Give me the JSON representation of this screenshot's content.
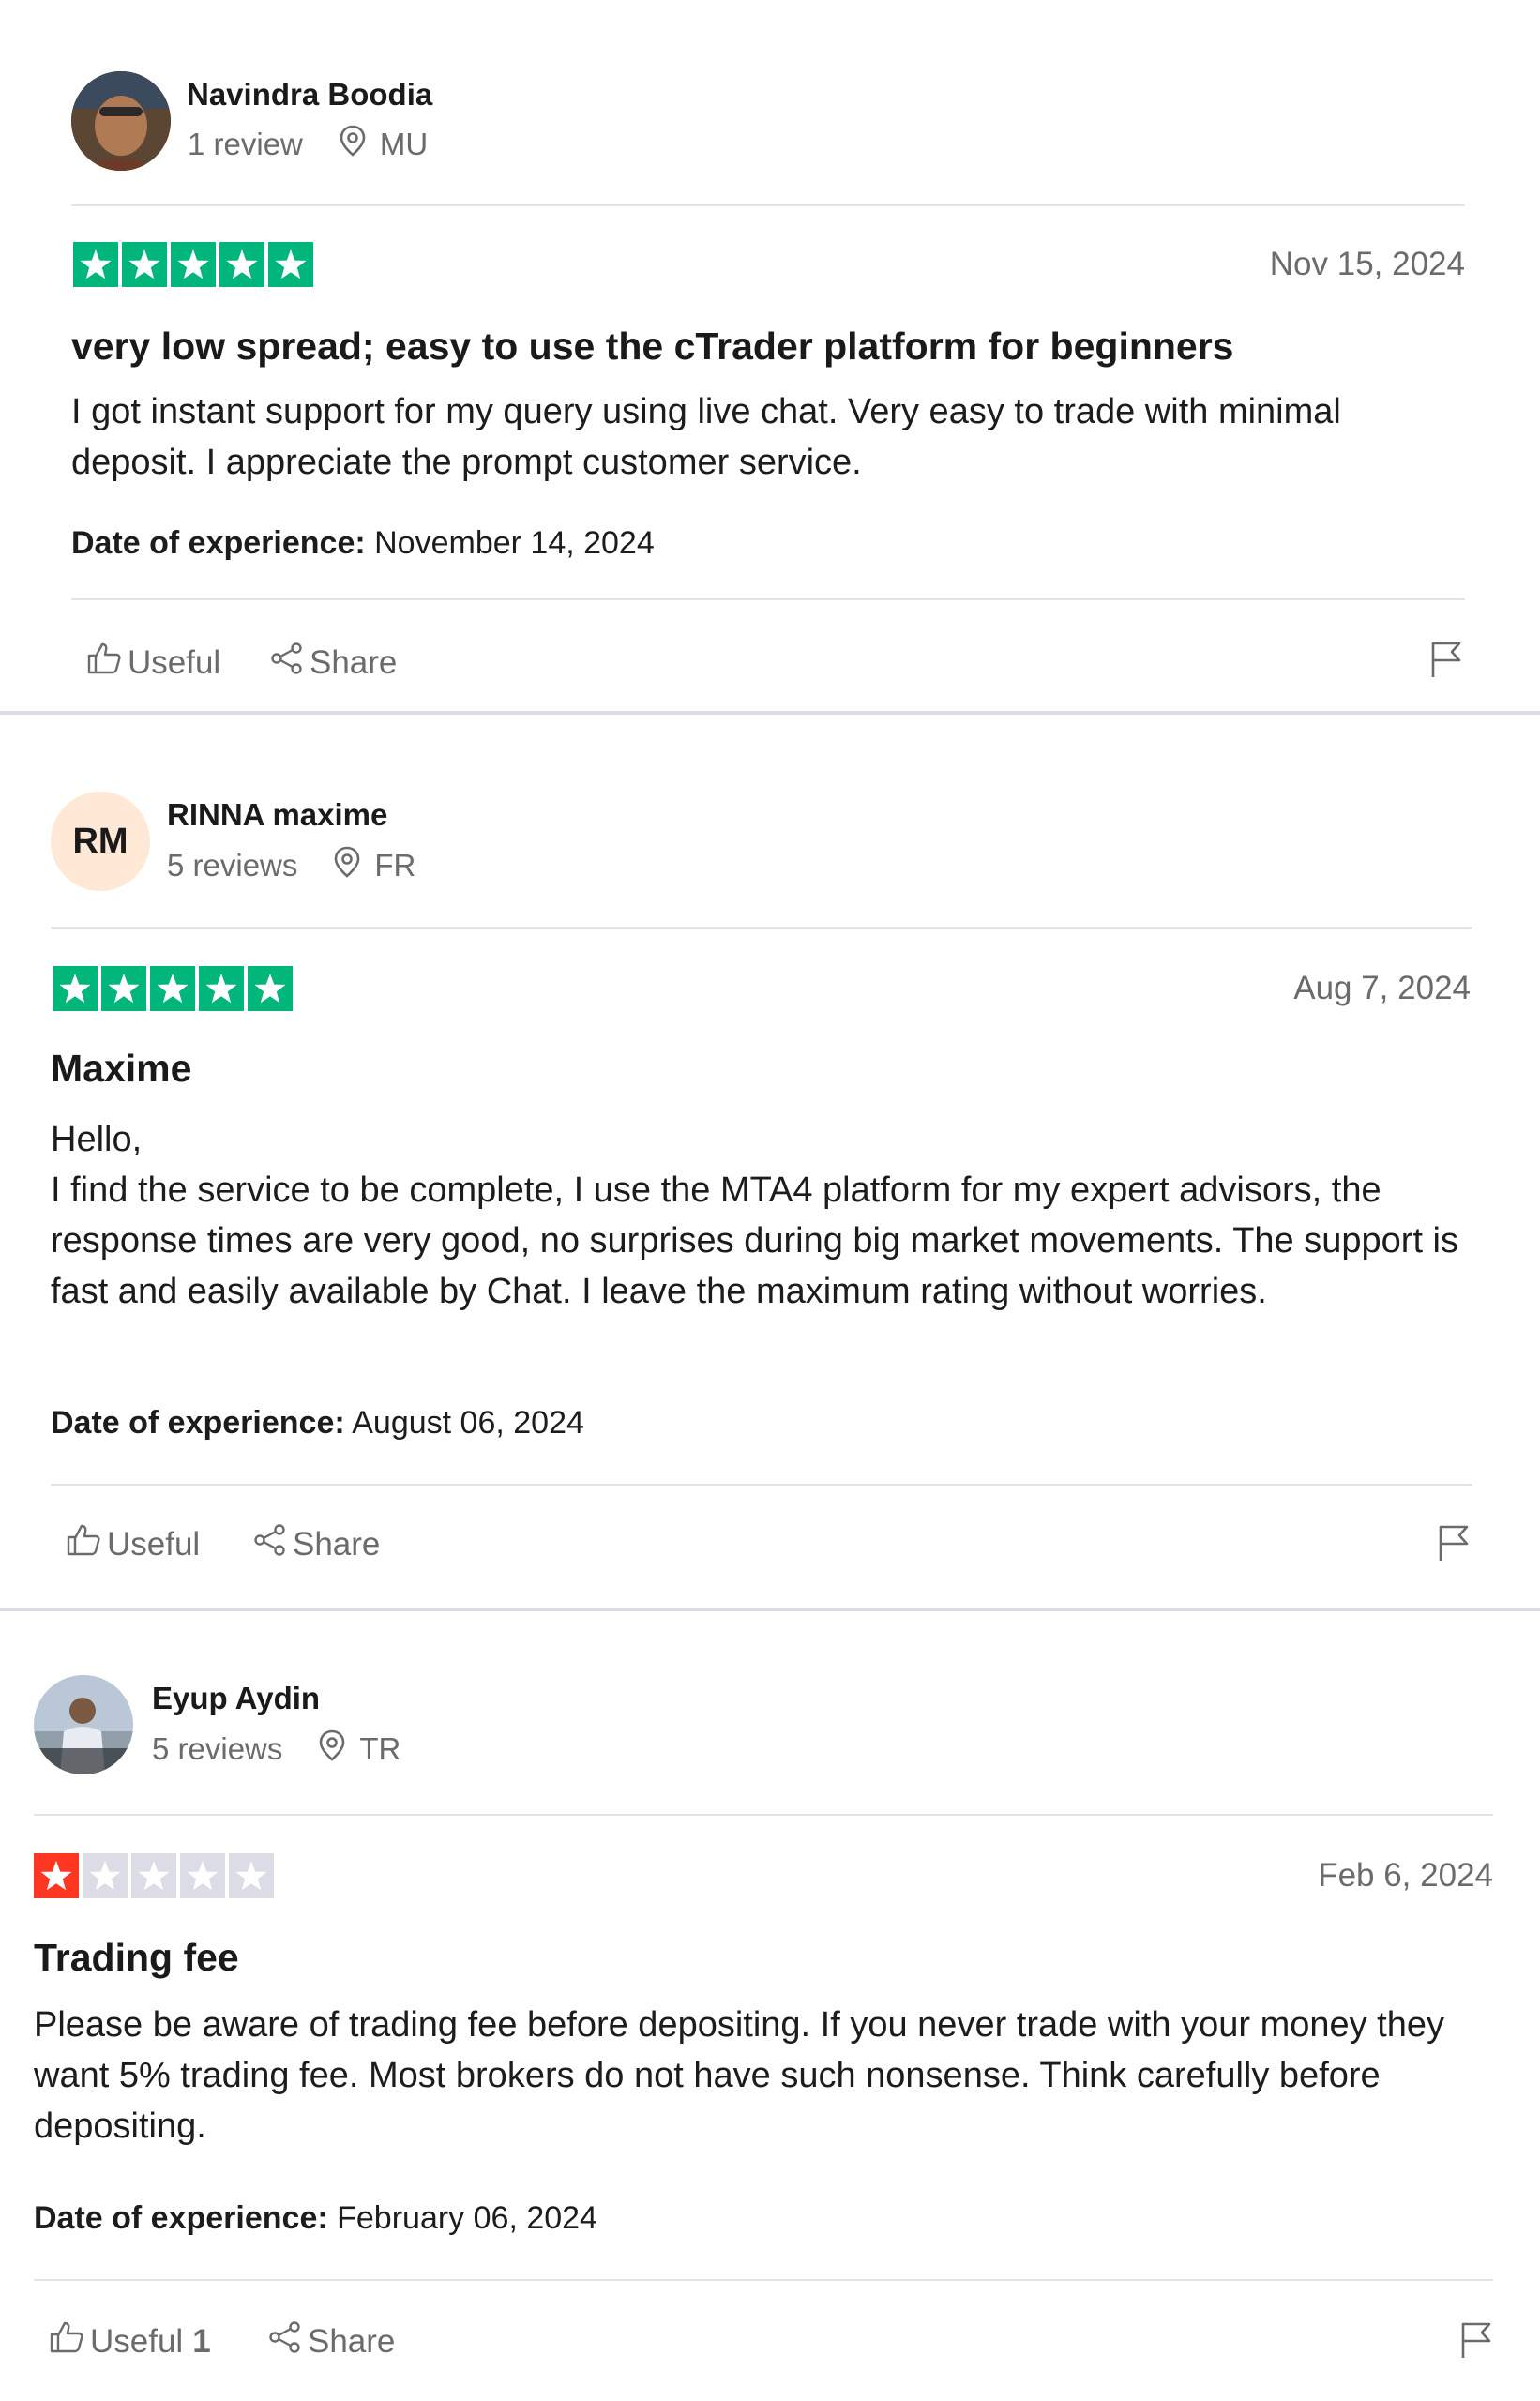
{
  "reviews": [
    {
      "reviewer": "Navindra Boodia",
      "review_count": "1 review",
      "country": "MU",
      "avatar": {
        "type": "photo",
        "initials": ""
      },
      "rating": 5,
      "date": "Nov 15, 2024",
      "title": "very low spread; easy to use the cTrader platform for beginners",
      "body": [
        "I got instant support for my query using live chat. Very easy to trade with minimal deposit. I appreciate the prompt customer service."
      ],
      "experience_label": "Date of experience:",
      "experience_date": "November 14, 2024",
      "useful_label": "Useful",
      "useful_count": "",
      "share_label": "Share"
    },
    {
      "reviewer": "RINNA maxime",
      "review_count": "5 reviews",
      "country": "FR",
      "avatar": {
        "type": "initials",
        "initials": "RM"
      },
      "rating": 5,
      "date": "Aug 7, 2024",
      "title": "Maxime",
      "body": [
        "Hello,",
        "I find the service to be complete, I use the MTA4 platform for my expert advisors, the response times are very good, no surprises during big market movements. The support is fast and easily available by Chat. I leave the maximum rating without worries."
      ],
      "experience_label": "Date of experience:",
      "experience_date": "August 06, 2024",
      "useful_label": "Useful",
      "useful_count": "",
      "share_label": "Share"
    },
    {
      "reviewer": "Eyup Aydin",
      "review_count": "5 reviews",
      "country": "TR",
      "avatar": {
        "type": "photo",
        "initials": ""
      },
      "rating": 1,
      "date": "Feb 6, 2024",
      "title": "Trading fee",
      "body": [
        "Please be aware of trading fee before depositing. If you never trade with your money they want 5% trading fee. Most brokers do not have such nonsense. Think carefully before depositing."
      ],
      "experience_label": "Date of experience:",
      "experience_date": "February 06, 2024",
      "useful_label": "Useful",
      "useful_count": "1",
      "share_label": "Share"
    }
  ],
  "colors": {
    "star_5": "#00b67a",
    "star_1": "#ff3722",
    "star_empty": "#dcdce6",
    "initials_bg": "#ffe8d6"
  },
  "icons": [
    "thumbs-up-icon",
    "share-icon",
    "flag-icon",
    "location-pin-icon"
  ]
}
